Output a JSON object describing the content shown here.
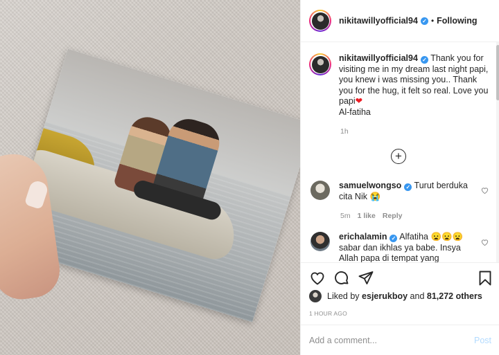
{
  "post": {
    "username": "nikitawillyofficial94",
    "verified": true,
    "follow_status": "Following",
    "separator": "•"
  },
  "caption": {
    "username": "nikitawillyofficial94",
    "text_part1": "Thank you for visiting me in my dream last night papi, you knew i was missing you.. Thank you for the hug, it felt so real. Love you papi",
    "emoji": "❤",
    "text_part2": "Al-fatiha",
    "time": "1h"
  },
  "load_more_icon": "plus-circle-icon",
  "comments": [
    {
      "username": "samuelwongso",
      "verified": true,
      "text": "Turut berduka cita Nik 😭",
      "time": "5m",
      "likes": "1 like",
      "reply_label": "Reply"
    },
    {
      "username": "erichalamin",
      "verified": true,
      "text": "Alfatiha 😦😦😦 sabar dan ikhlas ya babe. Insya Allah papa di tempat yang"
    }
  ],
  "actions": {
    "like_icon": "heart-icon",
    "comment_icon": "comment-icon",
    "share_icon": "send-icon",
    "save_icon": "bookmark-icon"
  },
  "likes": {
    "prefix": "Liked by",
    "user": "esjerukboy",
    "middle": "and",
    "others": "81,272 others"
  },
  "posted_ago": "1 HOUR AGO",
  "comment_box": {
    "placeholder": "Add a comment...",
    "post_label": "Post"
  },
  "colors": {
    "verified_blue": "#3897f0",
    "muted_text": "#8e8e8e",
    "post_disabled": "#b3dbff",
    "heart_red": "#ed1c24"
  }
}
